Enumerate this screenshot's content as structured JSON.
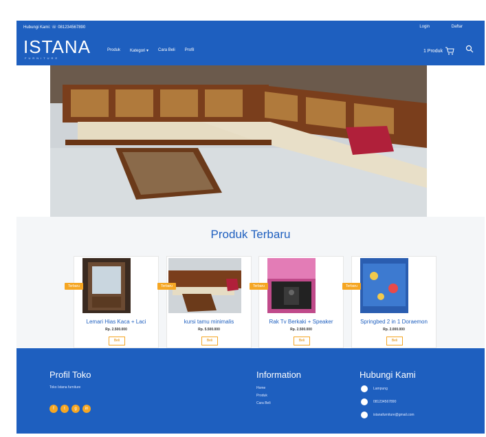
{
  "topbar": {
    "contact_label": "Hubungi Kami: ☏ 081234567890",
    "login": "Login",
    "register": "Daftar"
  },
  "nav": {
    "logo": "ISTANA",
    "logo_sub": "FURNITURE",
    "menu": [
      "Produk",
      "Kategori ▾",
      "Cara Beli",
      "Profil"
    ],
    "cart_label": "1 Produk"
  },
  "products": {
    "title": "Produk Terbaru",
    "items": [
      {
        "badge": "Terbaru",
        "name": "Lemari Hias Kaca + Laci",
        "price": "Rp. 2.500.000",
        "button": "Beli"
      },
      {
        "badge": "Terbaru",
        "name": "kursi tamu minimalis",
        "price": "Rp. 5.500.000",
        "button": "Beli"
      },
      {
        "badge": "Terbaru",
        "name": "Rak Tv Berkaki + Speaker",
        "price": "Rp. 2.500.000",
        "button": "Beli"
      },
      {
        "badge": "Terbaru",
        "name": "Springbed 2 in 1 Doraemon",
        "price": "Rp. 2.000.000",
        "button": "Beli"
      }
    ]
  },
  "footer": {
    "profil": {
      "title": "Profil Toko",
      "text": "Toko Istana furniture"
    },
    "information": {
      "title": "Information",
      "links": [
        "Home",
        "Produk",
        "Cara Beli"
      ]
    },
    "contact": {
      "title": "Hubungi Kami",
      "address": "Lampung",
      "phone": "081234567890",
      "email": "istanafurniture@gmail.com"
    },
    "social": [
      "f",
      "t",
      "g",
      "in"
    ]
  },
  "colors": {
    "primary": "#1e5fbf",
    "accent": "#f5a623"
  }
}
